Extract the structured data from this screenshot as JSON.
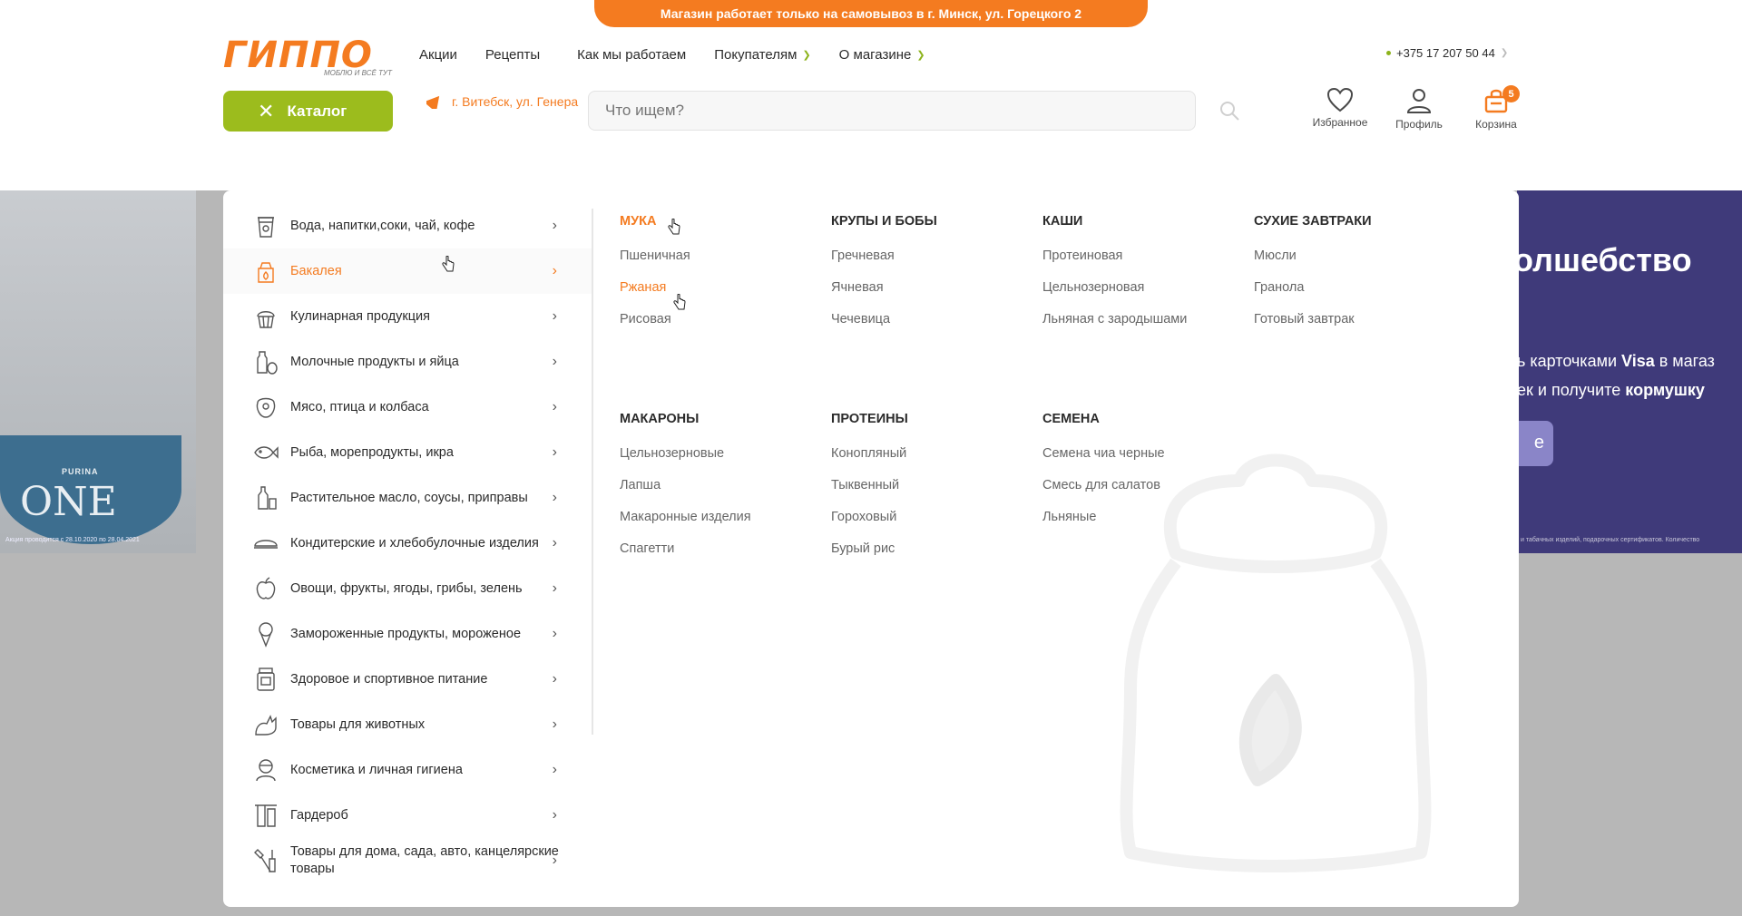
{
  "notice": "Магазин работает только на самовывоз в г. Минск, ул. Горецкого 2",
  "logo": {
    "text": "ГИППО",
    "tagline": "МОБЛЮ И ВСЁ ТУТ"
  },
  "nav": [
    {
      "label": "Акции",
      "has_dropdown": false
    },
    {
      "label": "Рецепты",
      "has_dropdown": false
    },
    {
      "label": "Как мы работаем",
      "has_dropdown": false
    },
    {
      "label": "Покупателям",
      "has_dropdown": true
    },
    {
      "label": "О магазине",
      "has_dropdown": true
    }
  ],
  "phone": "+375 17 207 50 44",
  "catalog_button": "Каталог",
  "location": "г. Витебск, ул. Генера",
  "search": {
    "placeholder": "Что ищем?"
  },
  "header_icons": {
    "favorites": "Избранное",
    "profile": "Профиль",
    "cart": "Корзина",
    "cart_count": "5"
  },
  "categories": [
    {
      "label": "Вода, напитки,соки, чай, кофе",
      "icon": "cup-icon",
      "active": false
    },
    {
      "label": "Бакалея",
      "icon": "bag-icon",
      "active": true
    },
    {
      "label": "Кулинарная продукция",
      "icon": "cupcake-icon",
      "active": false
    },
    {
      "label": "Молочные продукты и яйца",
      "icon": "milk-icon",
      "active": false
    },
    {
      "label": "Мясо, птица и колбаса",
      "icon": "meat-icon",
      "active": false
    },
    {
      "label": "Рыба, морепродукты, икра",
      "icon": "fish-icon",
      "active": false
    },
    {
      "label": "Растительное масло, соусы, приправы",
      "icon": "oil-bottle-icon",
      "active": false
    },
    {
      "label": "Кондитерские и хлебобулочные изделия",
      "icon": "cake-icon",
      "active": false
    },
    {
      "label": "Овощи, фрукты, ягоды, грибы, зелень",
      "icon": "apple-icon",
      "active": false
    },
    {
      "label": "Замороженные продукты, мороженое",
      "icon": "ice-cream-icon",
      "active": false
    },
    {
      "label": "Здоровое и спортивное питание",
      "icon": "protein-jar-icon",
      "active": false
    },
    {
      "label": "Товары для животных",
      "icon": "cat-icon",
      "active": false
    },
    {
      "label": "Косметика и личная гигиена",
      "icon": "cosmetics-icon",
      "active": false
    },
    {
      "label": "Гардероб",
      "icon": "wardrobe-icon",
      "active": false
    },
    {
      "label": "Товары для дома, сада, авто, канцелярские товары",
      "icon": "tools-icon",
      "active": false
    }
  ],
  "subcategories": [
    {
      "title": "МУКА",
      "highlight": true,
      "items": [
        {
          "label": "Пшеничная",
          "highlight": false
        },
        {
          "label": "Ржаная",
          "highlight": true
        },
        {
          "label": "Рисовая",
          "highlight": false
        }
      ]
    },
    {
      "title": "КРУПЫ И БОБЫ",
      "highlight": false,
      "items": [
        {
          "label": "Гречневая",
          "highlight": false
        },
        {
          "label": "Ячневая",
          "highlight": false
        },
        {
          "label": "Чечевица",
          "highlight": false
        }
      ]
    },
    {
      "title": "КАШИ",
      "highlight": false,
      "items": [
        {
          "label": "Протеиновая",
          "highlight": false
        },
        {
          "label": "Цельнозерновая",
          "highlight": false
        },
        {
          "label": "Льняная с зародышами",
          "highlight": false
        }
      ]
    },
    {
      "title": "СУХИЕ ЗАВТРАКИ",
      "highlight": false,
      "items": [
        {
          "label": "Мюсли",
          "highlight": false
        },
        {
          "label": "Гранола",
          "highlight": false
        },
        {
          "label": "Готовый завтрак",
          "highlight": false
        }
      ]
    },
    {
      "title": "МАКАРОНЫ",
      "highlight": false,
      "items": [
        {
          "label": "Цельнозерновые",
          "highlight": false
        },
        {
          "label": "Лапша",
          "highlight": false
        },
        {
          "label": "Макаронные изделия",
          "highlight": false
        },
        {
          "label": "Спагетти",
          "highlight": false
        }
      ]
    },
    {
      "title": "ПРОТЕИНЫ",
      "highlight": false,
      "items": [
        {
          "label": "Конопляный",
          "highlight": false
        },
        {
          "label": "Тыквенный",
          "highlight": false
        },
        {
          "label": "Гороховый",
          "highlight": false
        },
        {
          "label": "Бурый рис",
          "highlight": false
        }
      ]
    },
    {
      "title": "СЕМЕНА",
      "highlight": false,
      "items": [
        {
          "label": "Семена чиа черные",
          "highlight": false
        },
        {
          "label": "Смесь для салатов",
          "highlight": false
        },
        {
          "label": "Льняные",
          "highlight": false
        }
      ]
    }
  ],
  "promo_left": {
    "brand": "PURINA",
    "product": "ONE",
    "fine_print": "Акция проводится с 28.10.2020 по 28.04.2021"
  },
  "promo_right": {
    "headline": "олшебство",
    "line1_pre": "ь карточками ",
    "line1_bold": "Visa",
    "line1_post": " в магаз",
    "line2_pre": "ек и получите ",
    "line2_bold": "кормушку",
    "button": "е",
    "fine_print": "и табачных изделий, подарочных сертификатов. Количество"
  },
  "colors": {
    "accent": "#f47b20",
    "green": "#9cbc1d",
    "promo_purple": "#3f3a7a"
  }
}
